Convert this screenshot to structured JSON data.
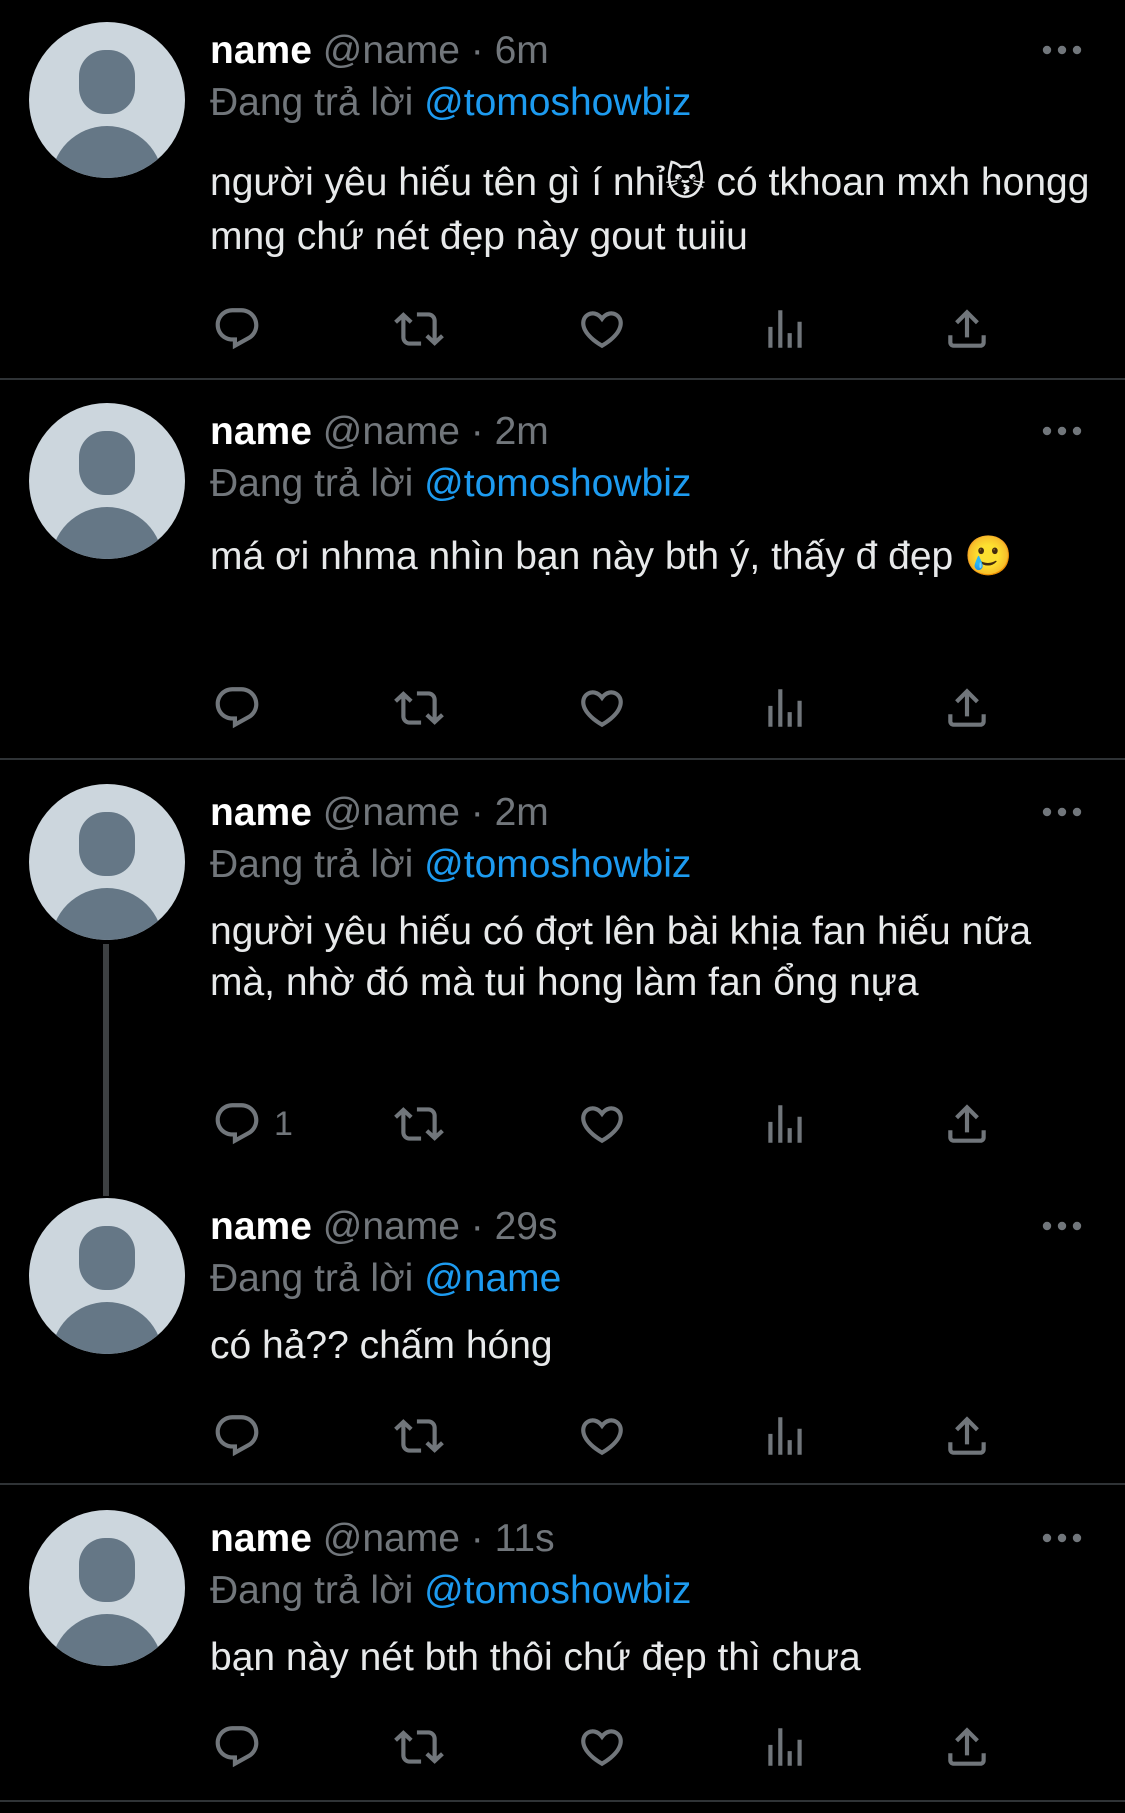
{
  "tweets": [
    {
      "name": "name",
      "handle": "@name",
      "dot": "·",
      "time": "6m",
      "reply_prefix": "Đang trả lời",
      "reply_to": "@tomoshowbiz",
      "text": "người yêu hiếu tên gì í nhỉ😽  có tkhoan mxh hongg mng chứ nét đẹp này gout tuiiu",
      "reply_count": ""
    },
    {
      "name": "name",
      "handle": "@name",
      "dot": "·",
      "time": "2m",
      "reply_prefix": "Đang trả lời",
      "reply_to": "@tomoshowbiz",
      "text": "má ơi nhma nhìn bạn này bth ý, thấy đ đẹp 🥲",
      "reply_count": ""
    },
    {
      "name": "name",
      "handle": "@name",
      "dot": "·",
      "time": "2m",
      "reply_prefix": "Đang trả lời",
      "reply_to": "@tomoshowbiz",
      "text": "người yêu hiếu có đợt lên bài khịa fan hiếu nữa mà, nhờ đó mà tui hong làm fan ổng nựa",
      "reply_count": "1"
    },
    {
      "name": "name",
      "handle": "@name",
      "dot": "·",
      "time": "29s",
      "reply_prefix": "Đang trả lời",
      "reply_to": "@name",
      "text": "có hả?? chấm hóng",
      "reply_count": ""
    },
    {
      "name": "name",
      "handle": "@name",
      "dot": "·",
      "time": "11s",
      "reply_prefix": "Đang trả lời",
      "reply_to": "@tomoshowbiz",
      "text": "bạn này nét bth thôi chứ đẹp thì chưa",
      "reply_count": ""
    }
  ],
  "icons": {
    "reply": "reply-icon",
    "retweet": "retweet-icon",
    "like": "heart-icon",
    "views": "views-icon",
    "share": "share-icon",
    "more": "more-icon"
  },
  "colors": {
    "background": "#000000",
    "muted": "#71767b",
    "mention": "#1d9bf0",
    "separator": "#2f3336"
  }
}
